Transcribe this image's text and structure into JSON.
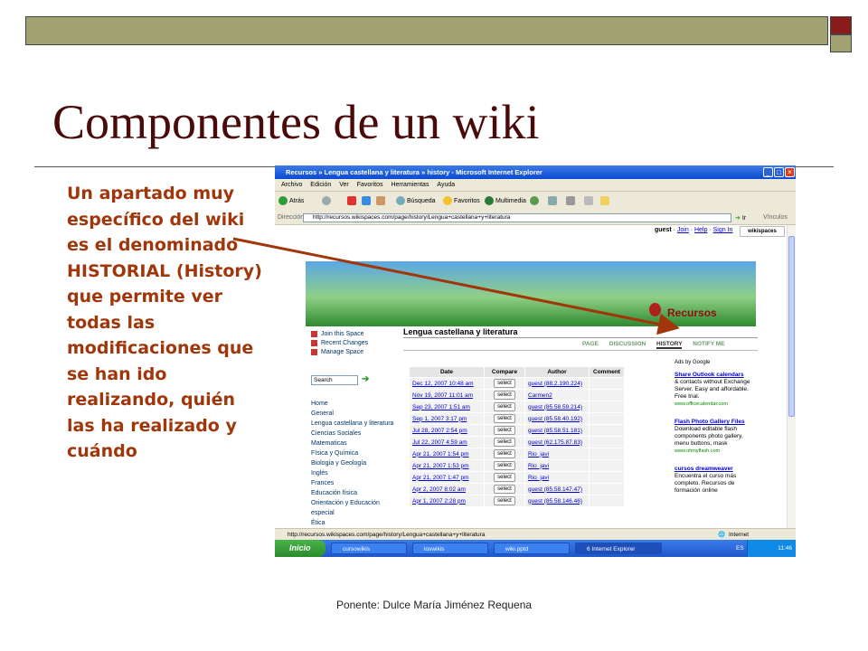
{
  "slide": {
    "title": "Componentes de un wiki",
    "body": "Un apartado muy específico del wiki es el denominado HISTORIAL (History) que permite ver todas las modificaciones que se han ido realizando, quién las ha realizado y cuándo",
    "footer": "Ponente: Dulce María Jiménez Requena",
    "colors": {
      "title": "#4a0a0a",
      "body": "#a0360a",
      "bar": "#a2a172",
      "accent_square": "#8b1a1a",
      "arrow": "#a0360a"
    }
  },
  "browser": {
    "window_title": "Recursos » Lengua castellana y literatura » history - Microsoft Internet Explorer",
    "menu": [
      "Archivo",
      "Edición",
      "Ver",
      "Favoritos",
      "Herramientas",
      "Ayuda"
    ],
    "toolbar": {
      "back": "Atrás",
      "search": "Búsqueda",
      "favorites": "Favoritos",
      "multimedia": "Multimedia"
    },
    "address_label": "Dirección",
    "address": "http://recursos.wikispaces.com/page/history/Lengua+castellana+y+literatura",
    "go": "Ir",
    "links": "Vínculos",
    "status_url": "http://recursos.wikispaces.com/page/history/Lengua+castellana+y+literatura",
    "status_zone": "Internet"
  },
  "wiki": {
    "guest": "guest",
    "join": "Join",
    "help": "Help",
    "signin": "Sign In",
    "logo": "wikispaces",
    "space_name": "Recursos",
    "sidebar_links": [
      "Join this Space",
      "Recent Changes",
      "Manage Space"
    ],
    "search_placeholder": "Search",
    "nav": [
      "Home",
      "General",
      "Lengua castellana y literatura",
      "Ciencias Sociales",
      "Matematicas",
      "Física y Química",
      "Biología y Geología",
      "Inglés",
      "Frances",
      "Educación física",
      "Orientación y Educación",
      "especial",
      "Ética"
    ],
    "page_title": "Lengua castellana y literatura",
    "tabs": [
      "PAGE",
      "DISCUSSION",
      "HISTORY",
      "NOTIFY ME"
    ],
    "active_tab": "HISTORY",
    "table_headers": [
      "Date",
      "Compare",
      "Author",
      "Comment"
    ],
    "select_label": "select",
    "rows": [
      {
        "date": "Dec 12, 2007 10:48 am",
        "author": "guest (88.2.190.224)"
      },
      {
        "date": "Nov 19, 2007 11:01 am",
        "author": "Carmen2"
      },
      {
        "date": "Sep 23, 2007 1:51 am",
        "author": "guest (85.58.59.214)"
      },
      {
        "date": "Sep 1, 2007 3:17 pm",
        "author": "guest (85.58.40.192)"
      },
      {
        "date": "Jul 28, 2007 2:54 pm",
        "author": "guest (85.58.51.181)"
      },
      {
        "date": "Jul 22, 2007 4:59 am",
        "author": "guest (62.175.87.83)"
      },
      {
        "date": "Apr 21, 2007 1:54 pm",
        "author": "Rio_javi"
      },
      {
        "date": "Apr 21, 2007 1:53 pm",
        "author": "Rio_javi"
      },
      {
        "date": "Apr 21, 2007 1:47 pm",
        "author": "Rio_javi"
      },
      {
        "date": "Apr 2, 2007 8:02 am",
        "author": "guest (85.58.147.47)"
      },
      {
        "date": "Apr 1, 2007 2:28 pm",
        "author": "guest (85.58.146.46)"
      }
    ],
    "ads_header": "Ads by Google",
    "ads": [
      {
        "title": "Share Outlook calendars",
        "text": "& contacts without Exchange Server. Easy and affordable. Free trial.",
        "url": "www.officecalendar.com"
      },
      {
        "title": "Flash Photo Gallery Files",
        "text": "Download editable flash components photo gallery, menu buttons, mask",
        "url": "www.ohmyflash.com"
      },
      {
        "title": "cursos dreamweaver",
        "text": "Encuentra el curso más completo. Recursos de formación online",
        "url": ""
      }
    ]
  },
  "taskbar": {
    "start": "Inicio",
    "tasks": [
      "cursowikis",
      "loswikis",
      "wiki.pptd",
      "6 Internet Explorer"
    ],
    "lang": "ES",
    "clock": "11:46"
  }
}
